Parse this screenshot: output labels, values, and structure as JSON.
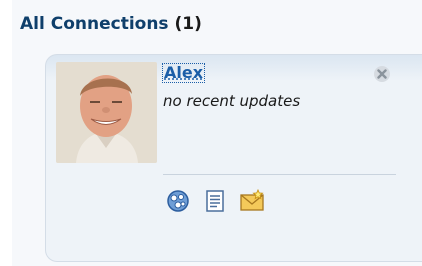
{
  "header": {
    "title": "All Connections",
    "count": "(1)"
  },
  "connection": {
    "name": "Alex",
    "status": "no recent updates",
    "remove_icon": "close-icon",
    "actions": [
      {
        "icon": "network-icon"
      },
      {
        "icon": "document-icon"
      },
      {
        "icon": "mail-invite-icon"
      }
    ]
  },
  "colors": {
    "header_text": "#0f3f6b",
    "name_link": "#1b5ea8",
    "card_bg": "#eef3f8"
  }
}
